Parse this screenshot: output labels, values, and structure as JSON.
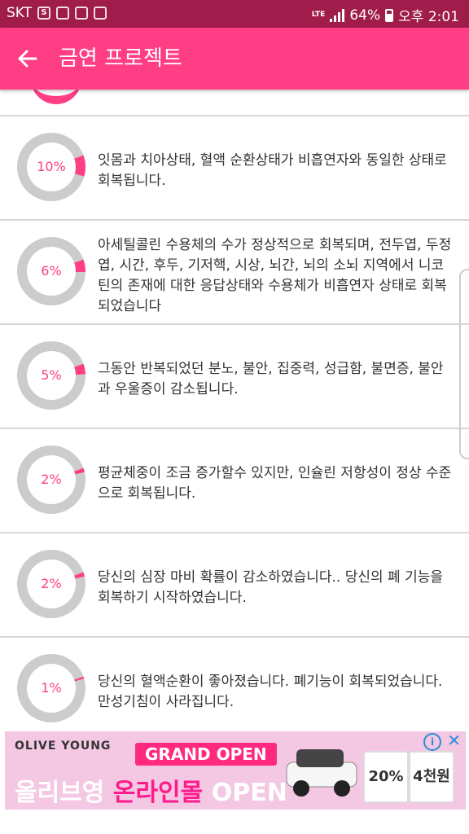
{
  "status_bar": {
    "carrier": "SKT",
    "network": "LTE",
    "battery": "64%",
    "time": "오후 2:01"
  },
  "app_bar": {
    "title": "금연 프로젝트"
  },
  "items": [
    {
      "percent_label": "10%",
      "progress": 0.1,
      "text": "잇몸과 치아상태, 혈액 순환상태가 비흡연자와 동일한 상태로 회복됩니다."
    },
    {
      "percent_label": "6%",
      "progress": 0.06,
      "text": "아세틸콜린 수용체의 수가 정상적으로 회복되며, 전두엽, 두정엽, 시간, 후두, 기저핵, 시상, 뇌간, 뇌의 소뇌 지역에서 니코틴의 존재에 대한 응답상태와 수용체가 비흡연자 상태로 회복되었습니다"
    },
    {
      "percent_label": "5%",
      "progress": 0.05,
      "text": "그동안 반복되었던 분노, 불안, 집중력, 성급함, 불면증, 불안과 우울증이 감소됩니다."
    },
    {
      "percent_label": "2%",
      "progress": 0.02,
      "text": "평균체중이 조금 증가할수 있지만, 인슐린 저항성이 정상 수준으로 회복됩니다."
    },
    {
      "percent_label": "2%",
      "progress": 0.02,
      "text": "당신의 심장 마비 확률이 감소하였습니다.. 당신의 폐 기능을 회복하기 시작하였습니다."
    },
    {
      "percent_label": "1%",
      "progress": 0.01,
      "text": "당신의 혈액순환이 좋아졌습니다. 폐기능이 회복되었습니다. 만성기침이 사라집니다."
    }
  ],
  "ad": {
    "brand": "OLIVE YOUNG",
    "badge": "GRAND OPEN",
    "headline_a": "올리브영",
    "headline_b": "온라인몰",
    "headline_c": "OPEN",
    "coupon_1": "20%",
    "coupon_2": "4천원"
  },
  "colors": {
    "accent": "#ff3e86",
    "status_bar": "#a01c4a",
    "ring_track": "#cccccc"
  }
}
